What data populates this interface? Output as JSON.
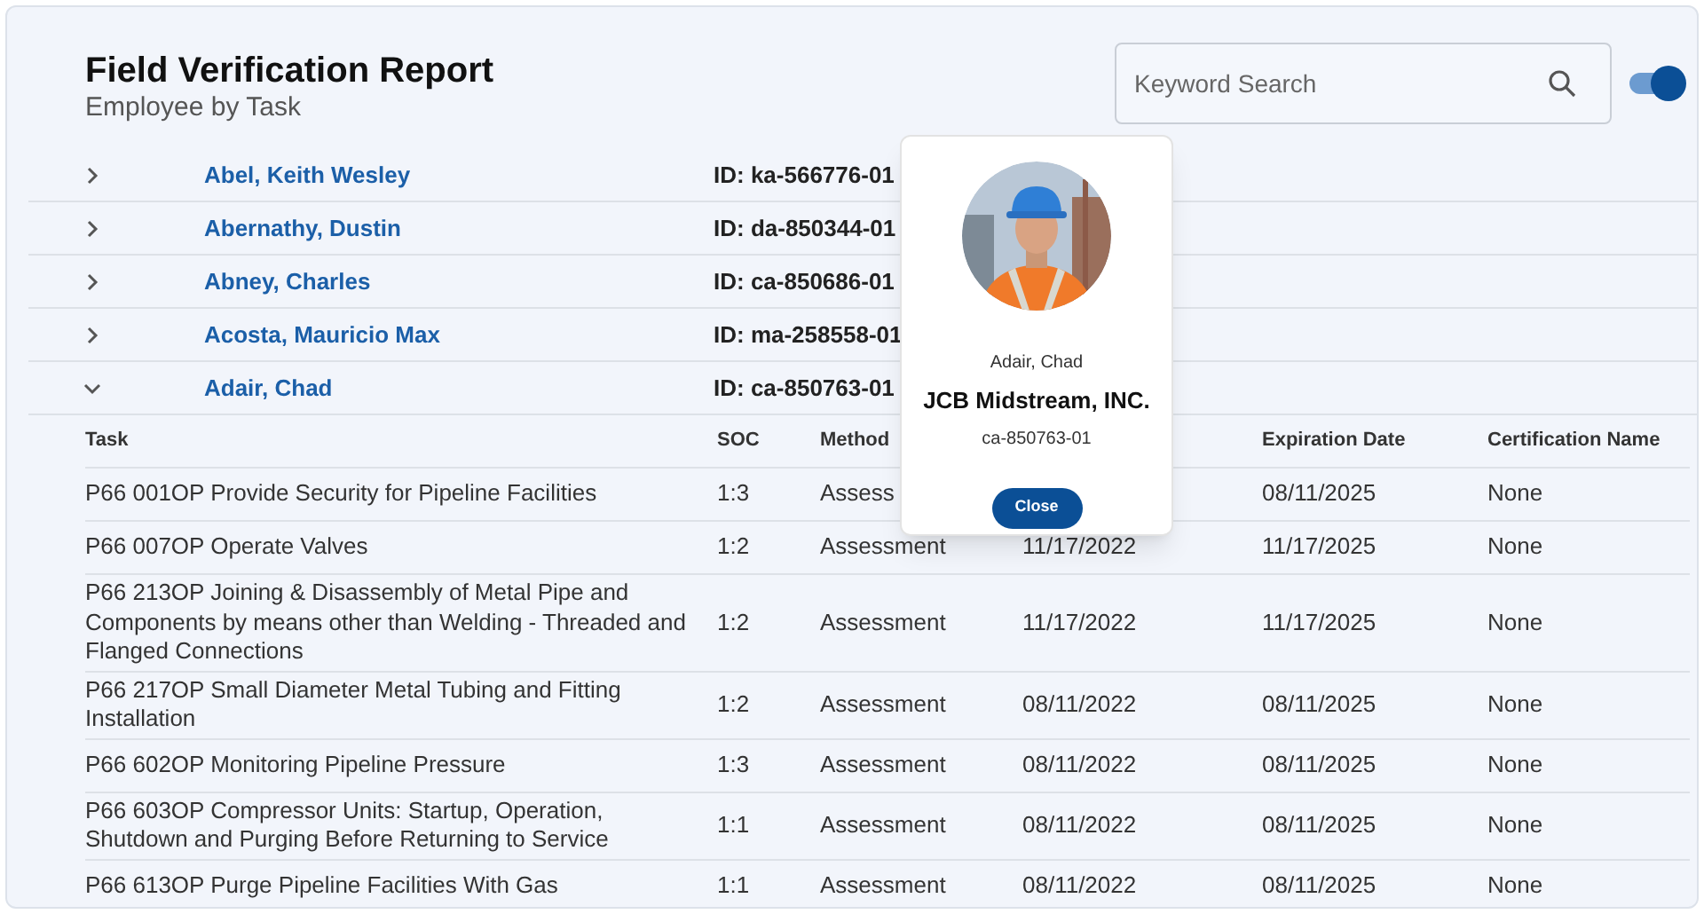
{
  "header": {
    "title": "Field Verification Report",
    "subtitle": "Employee by Task"
  },
  "search": {
    "placeholder": "Keyword Search"
  },
  "toggle": {
    "on": true
  },
  "employees": [
    {
      "name": "Abel, Keith Wesley",
      "id": "ID: ka-566776-01",
      "expanded": false
    },
    {
      "name": "Abernathy, Dustin",
      "id": "ID: da-850344-01",
      "expanded": false
    },
    {
      "name": "Abney, Charles",
      "id": "ID: ca-850686-01",
      "expanded": false
    },
    {
      "name": "Acosta, Mauricio Max",
      "id": "ID: ma-258558-01",
      "expanded": false
    },
    {
      "name": "Adair, Chad",
      "id": "ID: ca-850763-01",
      "expanded": true,
      "task_table": {
        "columns": [
          "Task",
          "SOC",
          "Method",
          null,
          "Expiration Date",
          "Certification Name"
        ],
        "rows": [
          [
            "P66 001OP Provide Security for Pipeline Facilities",
            "1:3",
            "Assess",
            null,
            "08/11/2025",
            "None"
          ],
          [
            "P66 007OP Operate Valves",
            "1:2",
            "Assessment",
            "11/17/2022",
            "11/17/2025",
            "None"
          ],
          [
            "P66 213OP Joining & Disassembly of Metal Pipe and Components by means other than Welding - Threaded and Flanged Connections",
            "1:2",
            "Assessment",
            "11/17/2022",
            "11/17/2025",
            "None"
          ],
          [
            "P66 217OP Small Diameter Metal Tubing and Fitting Installation",
            "1:2",
            "Assessment",
            "08/11/2022",
            "08/11/2025",
            "None"
          ],
          [
            "P66 602OP Monitoring Pipeline Pressure",
            "1:3",
            "Assessment",
            "08/11/2022",
            "08/11/2025",
            "None"
          ],
          [
            "P66 603OP Compressor Units: Startup, Operation, Shutdown and Purging Before Returning to Service",
            "1:1",
            "Assessment",
            "08/11/2022",
            "08/11/2025",
            "None"
          ],
          [
            "P66 613OP Purge Pipeline Facilities With Gas",
            "1:1",
            "Assessment",
            "08/11/2022",
            "08/11/2025",
            "None"
          ]
        ]
      }
    }
  ],
  "profile_popup": {
    "kind": "picture",
    "name": "Adair, Chad",
    "company": "JCB Midstream, INC.",
    "employee_id": "ca-850763-01",
    "button": "Close"
  }
}
